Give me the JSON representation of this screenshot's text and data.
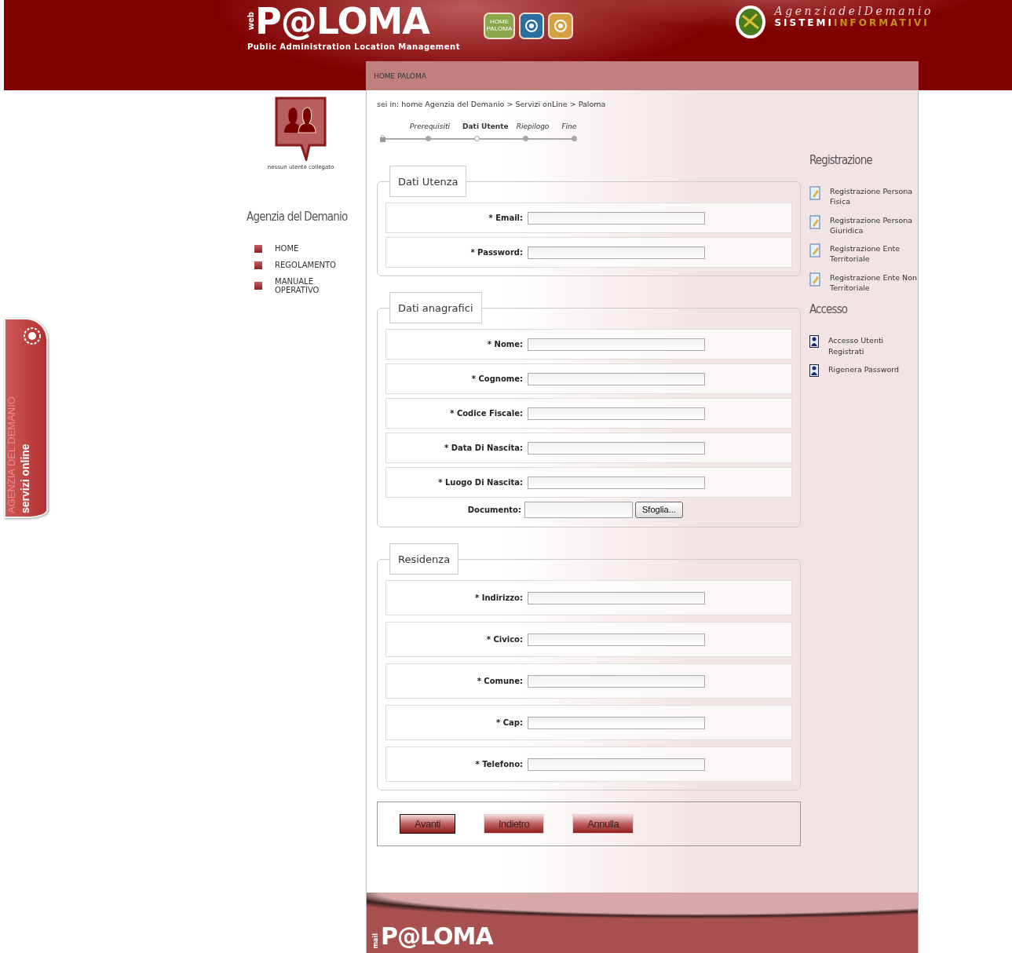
{
  "header": {
    "web_mark": "web",
    "logo": "P@LOMA",
    "subtitle": "Public Administration Location Management",
    "home_tile": "HOME PALOMA",
    "agency": "AgenziadelDemanio",
    "systems": "SISTEMI",
    "informatics": "INFORMATIVI"
  },
  "nav_bar": {
    "label": "HOME PALOMA"
  },
  "user_panel": {
    "status": "nessun utente collegato"
  },
  "sidebar": {
    "title": "Agenzia del Demanio",
    "items": [
      {
        "label": "HOME"
      },
      {
        "label": "REGOLAMENTO"
      },
      {
        "label": "MANUALE OPERATIVO"
      }
    ]
  },
  "breadcrumb": "sei in: home Agenzia del Demanio > Servizi onLine > Paloma",
  "steps": [
    {
      "label": "Prerequisiti",
      "selected": false
    },
    {
      "label": "Dati Utente",
      "selected": true
    },
    {
      "label": "Riepilogo",
      "selected": false
    },
    {
      "label": "Fine",
      "selected": false
    }
  ],
  "sections": [
    {
      "title": "Dati Utenza",
      "fields": [
        {
          "kind": "text",
          "label": "* Email:"
        },
        {
          "kind": "text",
          "label": "* Password:"
        }
      ]
    },
    {
      "title": "Dati anagrafici",
      "fields": [
        {
          "kind": "text",
          "label": "* Nome:"
        },
        {
          "kind": "text",
          "label": "* Cognome:"
        },
        {
          "kind": "text",
          "label": "* Codice Fiscale:"
        },
        {
          "kind": "text",
          "label": "* Data Di Nascita:"
        },
        {
          "kind": "text",
          "label": "* Luogo Di Nascita:"
        },
        {
          "kind": "file",
          "label": "Documento:",
          "button": "Sfoglia..."
        }
      ]
    },
    {
      "title": "Residenza",
      "fields": [
        {
          "kind": "text",
          "label": "* Indirizzo:"
        },
        {
          "kind": "text",
          "label": "* Civico:"
        },
        {
          "kind": "text",
          "label": "* Comune:"
        },
        {
          "kind": "text",
          "label": "* Cap:"
        },
        {
          "kind": "text",
          "label": "* Telefono:"
        }
      ]
    }
  ],
  "buttons": [
    {
      "label": "Avanti",
      "focused": true
    },
    {
      "label": "Indietro",
      "focused": false
    },
    {
      "label": "Annulla",
      "focused": false
    }
  ],
  "right_panel": [
    {
      "title": "Registrazione",
      "kind": "edit",
      "items": [
        {
          "label": "Registrazione Persona Fisica"
        },
        {
          "label": "Registrazione Persona Giuridica"
        },
        {
          "label": "Registrazione Ente Territoriale"
        },
        {
          "label": "Registrazione Ente Non Territoriale"
        }
      ]
    },
    {
      "title": "Accesso",
      "kind": "user",
      "items": [
        {
          "label": "Accesso Utenti Registrati"
        },
        {
          "label": "Rigenera Password"
        }
      ]
    }
  ],
  "side_tab": {
    "agency": "AGENZIA DEL DEMANIO",
    "label": "servizi online"
  },
  "footer": {
    "mark": "mail",
    "logo": "P@LOMA"
  }
}
